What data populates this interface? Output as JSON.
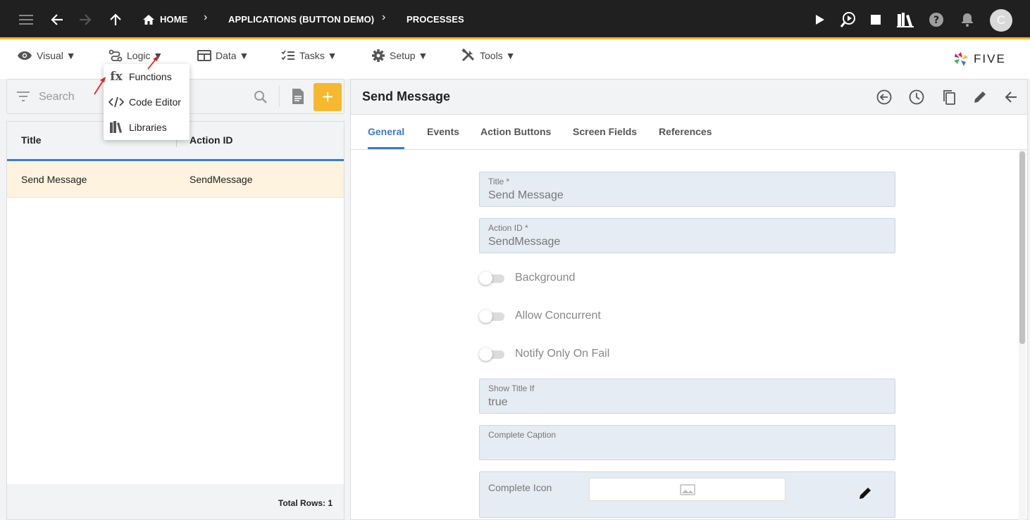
{
  "topbar": {
    "breadcrumbs": [
      "HOME",
      "APPLICATIONS (BUTTON DEMO)",
      "PROCESSES"
    ],
    "avatar_initial": "C",
    "icons": [
      "menu-icon",
      "back-icon",
      "forward-icon",
      "up-icon",
      "home-icon",
      "play-icon",
      "run-search-icon",
      "stop-icon",
      "library-icon",
      "help-icon",
      "bell-icon"
    ]
  },
  "menubar": {
    "items": [
      "Visual ▼",
      "Logic ▼",
      "Data ▼",
      "Tasks ▼",
      "Setup ▼",
      "Tools ▼"
    ],
    "logo_text": "FIVE"
  },
  "dropdown": {
    "items": [
      "Functions",
      "Code Editor",
      "Libraries"
    ],
    "functions_glyph": "fx"
  },
  "list": {
    "search_placeholder": "Search",
    "columns": [
      "Title",
      "Action ID"
    ],
    "rows": [
      {
        "title": "Send Message",
        "action_id": "SendMessage"
      }
    ],
    "total_rows": "Total Rows: 1"
  },
  "form": {
    "title": "Send Message",
    "tabs": [
      "General",
      "Events",
      "Action Buttons",
      "Screen Fields",
      "References"
    ],
    "active_tab": "General",
    "fields": {
      "title_label": "Title *",
      "title_value": "Send Message",
      "action_id_label": "Action ID *",
      "action_id_value": "SendMessage",
      "show_title_if_label": "Show Title If",
      "show_title_if_value": "true",
      "complete_caption_label": "Complete Caption",
      "complete_caption_value": "",
      "complete_icon_label": "Complete Icon"
    },
    "toggles": [
      "Background",
      "Allow Concurrent",
      "Notify Only On Fail"
    ]
  },
  "colors": {
    "topbar_bg": "#202020",
    "accent_yellow": "#f5b82e",
    "tab_blue": "#3a7bd5",
    "selected_row": "#fdf3de",
    "annotation_arrow": "#e8201a"
  }
}
